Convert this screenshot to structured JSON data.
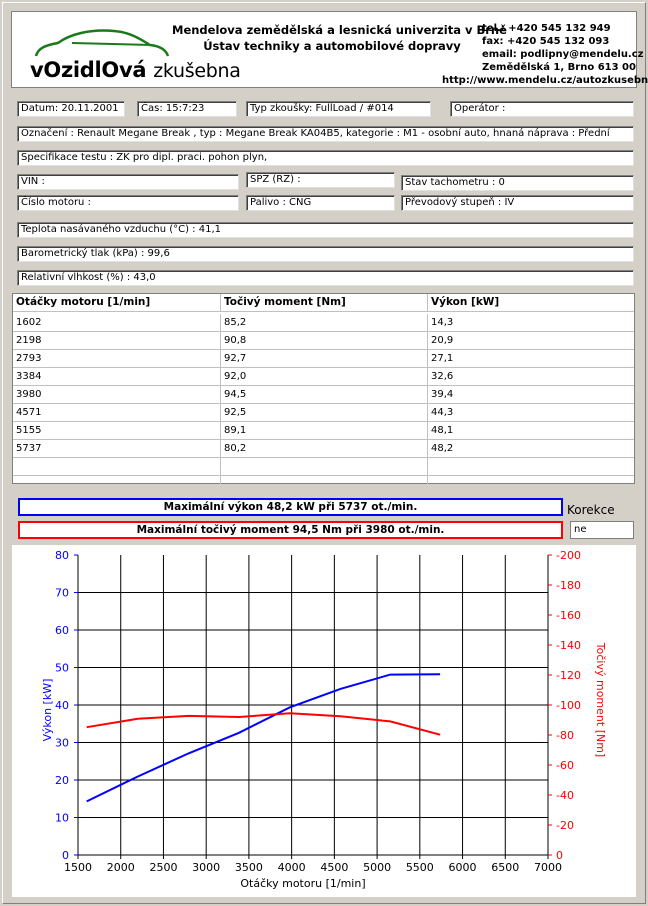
{
  "header": {
    "logo_prefix": "vOzidlOvá",
    "logo_suffix": "zkušebna",
    "university": "Mendelova zemědělská a lesnická univerzita v Brně",
    "institute": "Ústav techniky a automobilové dopravy",
    "tel": "tel.: +420 545 132 949",
    "fax": "fax: +420 545 132 093",
    "email": "email: podlipny@mendelu.cz",
    "address": "Zemědělská 1, Brno 613 00",
    "web": "http://www.mendelu.cz/autozkusebna"
  },
  "info": {
    "datum": "Datum: 20.11.2001",
    "cas": "Čas: 15:7:23",
    "typ_zkousky": "Typ zkoušky: FullLoad / #014",
    "operator": "Operátor :",
    "oznaceni": "Označení : Renault Megane Break , typ : Megane Break KA04B5, kategorie : M1 - osobní auto, hnaná náprava : Přední",
    "specifikace": "Specifikace testu : ZK pro dipl. praci. pohon plyn,",
    "vin": "VIN :",
    "spz": "SPZ (RZ) :",
    "tachometr": "Stav tachometru : 0",
    "cislo_motoru": "Číslo motoru :",
    "palivo": "Palivo : CNG",
    "prevodovy_stupen": "Převodový stupeň : IV",
    "teplota": "Teplota nasávaného vzduchu (°C) : 41,1",
    "tlak": "Barometrický tlak (kPa) : 99,6",
    "vlhkost": "Relativní vlhkost (%) : 43,0"
  },
  "table": {
    "headers": [
      "Otáčky motoru [1/min]",
      "Točivý moment [Nm]",
      "Výkon [kW]"
    ],
    "rows": [
      [
        "1602",
        "85,2",
        "14,3"
      ],
      [
        "2198",
        "90,8",
        "20,9"
      ],
      [
        "2793",
        "92,7",
        "27,1"
      ],
      [
        "3384",
        "92,0",
        "32,6"
      ],
      [
        "3980",
        "94,5",
        "39,4"
      ],
      [
        "4571",
        "92,5",
        "44,3"
      ],
      [
        "5155",
        "89,1",
        "48,1"
      ],
      [
        "5737",
        "80,2",
        "48,2"
      ]
    ]
  },
  "summary": {
    "max_power": "Maximální výkon 48,2 kW při 5737 ot./min.",
    "max_torque": "Maximální točivý moment 94,5 Nm při 3980 ot./min.",
    "korekce_label": "Korekce",
    "korekce_value": "ne"
  },
  "chart_data": {
    "type": "line",
    "xlabel": "Otáčky motoru [1/min]",
    "ylabel_left": "Výkon [kW]",
    "ylabel_right": "Točivý moment [Nm]",
    "xlim": [
      1500,
      7000
    ],
    "xticks": [
      "1500",
      "2000",
      "2500",
      "3000",
      "3500",
      "4000",
      "4500",
      "5000",
      "5500",
      "6000",
      "6500",
      "7000"
    ],
    "ylim_left": [
      0,
      80
    ],
    "yticks_left": [
      "0",
      "10",
      "20",
      "30",
      "40",
      "50",
      "60",
      "70",
      "80"
    ],
    "ylim_right": [
      0,
      -200
    ],
    "yticks_right": [
      "0",
      "-20",
      "-40",
      "-60",
      "-80",
      "-100",
      "-120",
      "-140",
      "-160",
      "-180",
      "-200"
    ],
    "grid": true,
    "colors": {
      "power": "#0000ff",
      "torque": "#ff0000"
    },
    "x": [
      1602,
      2198,
      2793,
      3384,
      3980,
      4571,
      5155,
      5737
    ],
    "series": [
      {
        "axis": "left",
        "color": "#0000ff",
        "values": [
          14.3,
          20.9,
          27.1,
          32.6,
          39.4,
          44.3,
          48.1,
          48.2
        ]
      },
      {
        "axis": "right",
        "color": "#ff0000",
        "values": [
          -85.2,
          -90.8,
          -92.7,
          -92.0,
          -94.5,
          -92.5,
          -89.1,
          -80.2
        ]
      }
    ]
  }
}
